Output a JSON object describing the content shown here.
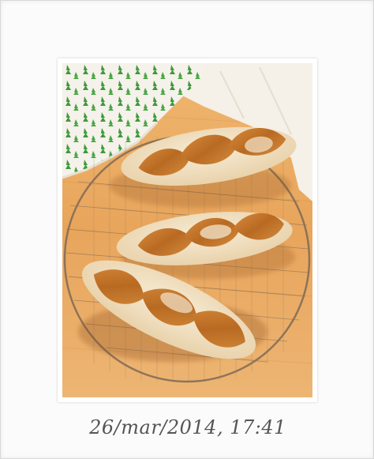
{
  "caption": {
    "text": "26/mar/2014, 17:41"
  },
  "photo": {
    "subject": "three baguettes on a round wire cooling rack",
    "colors": {
      "wood": "#e8a55c",
      "crust": "#c77a2a",
      "flour": "#f1e3c9",
      "towel_green": "#3e9a3b"
    }
  }
}
